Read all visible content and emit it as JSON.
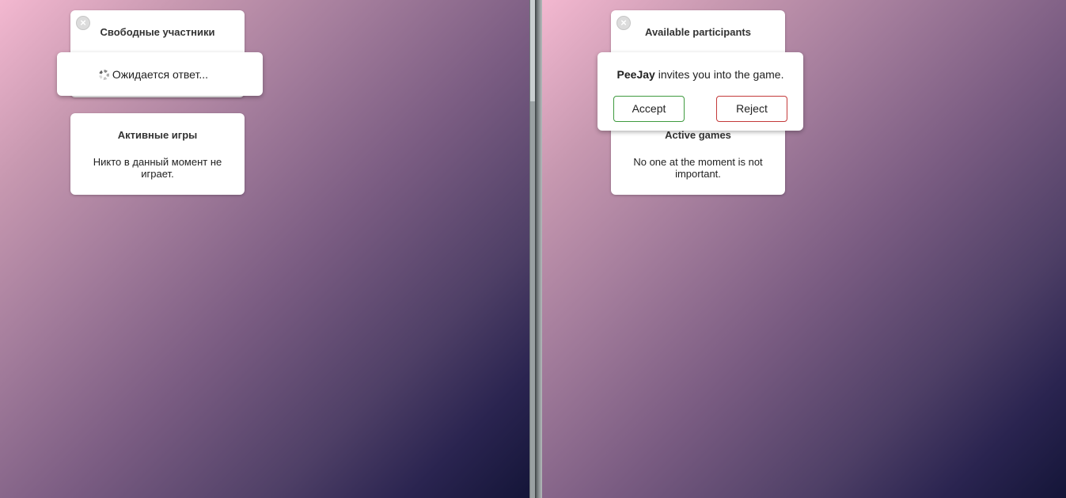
{
  "left": {
    "participants_card": {
      "title": "Свободные участники",
      "close": "×"
    },
    "waiting_popup": {
      "text": "Ожидается ответ..."
    },
    "games_card": {
      "title": "Активные игры",
      "empty_text": "Никто в данный момент не играет."
    }
  },
  "right": {
    "participants_card": {
      "title": "Available participants",
      "close": "×"
    },
    "invite_popup": {
      "inviter": "PeeJay",
      "message": " invites you into the game.",
      "accept_label": "Accept",
      "reject_label": "Reject"
    },
    "games_card": {
      "title": "Active games",
      "empty_text": "No one at the moment is not important."
    }
  },
  "colors": {
    "accept_border": "#3f9a3f",
    "reject_border": "#c43a3a",
    "background_top": "#f3b8d0",
    "background_bottom": "#141538"
  }
}
